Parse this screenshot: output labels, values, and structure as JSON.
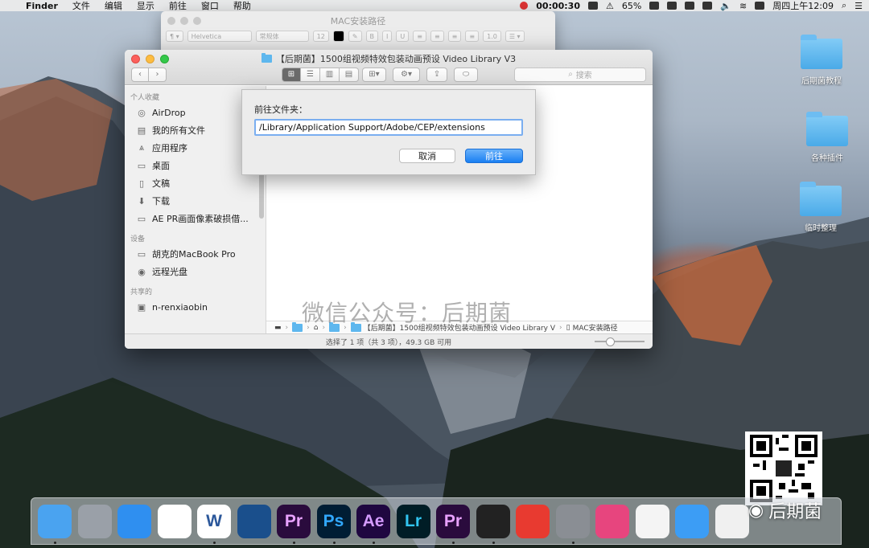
{
  "menubar": {
    "app": "Finder",
    "items": [
      "文件",
      "编辑",
      "显示",
      "前往",
      "窗口",
      "帮助"
    ],
    "timer": "00:00:30",
    "battery": "65%",
    "clock": "周四上午12:09"
  },
  "textedit": {
    "title": "MAC安装路径",
    "font": "Helvetica",
    "style": "常规体",
    "size": "12",
    "spacing": "1.0"
  },
  "finder": {
    "title": "【后期菌】1500组视频特效包装动画预设 Video Library V3",
    "search_placeholder": "搜索",
    "sidebar": {
      "favorites_header": "个人收藏",
      "favorites": [
        {
          "label": "AirDrop",
          "icon": "airdrop-icon"
        },
        {
          "label": "我的所有文件",
          "icon": "all-files-icon"
        },
        {
          "label": "应用程序",
          "icon": "applications-icon"
        },
        {
          "label": "桌面",
          "icon": "desktop-icon"
        },
        {
          "label": "文稿",
          "icon": "documents-icon"
        },
        {
          "label": "下载",
          "icon": "downloads-icon"
        },
        {
          "label": "AE PR画面像素破损借...",
          "icon": "folder-icon"
        }
      ],
      "devices_header": "设备",
      "devices": [
        {
          "label": "胡克的MacBook Pro",
          "icon": "laptop-icon"
        },
        {
          "label": "远程光盘",
          "icon": "disc-icon"
        }
      ],
      "shared_header": "共享的",
      "shared": [
        {
          "label": "n-renxiaobin",
          "icon": "monitor-icon"
        }
      ]
    },
    "pathbar": [
      "【后期菌】1500组视频特效包装动画预设 Video Library V",
      "MAC安装路径"
    ],
    "status": "选择了 1 项（共 3 项），49.3 GB 可用"
  },
  "goto_sheet": {
    "label": "前往文件夹：",
    "path_value": "/Library/Application Support/Adobe/CEP/extensions",
    "cancel": "取消",
    "go": "前往"
  },
  "desktop_folders": [
    "后期菌教程",
    "各种插件",
    "临时整理"
  ],
  "watermark": "微信公众号：后期菌",
  "wechat_brand": "后期菌",
  "dock": [
    {
      "name": "finder-dock-icon",
      "text": "",
      "bg": "#4aa3f0",
      "fg": "#fff"
    },
    {
      "name": "launchpad-dock-icon",
      "text": "",
      "bg": "#9aa0a8",
      "fg": "#fff"
    },
    {
      "name": "safari-dock-icon",
      "text": "",
      "bg": "#2f8ff0",
      "fg": "#fff"
    },
    {
      "name": "photos-dock-icon",
      "text": "",
      "bg": "#ffffff",
      "fg": "#e0474c"
    },
    {
      "name": "word-dock-icon",
      "text": "W",
      "bg": "#ffffff",
      "fg": "#2b579a"
    },
    {
      "name": "quicktime-dock-icon",
      "text": "",
      "bg": "#1a4f8c",
      "fg": "#e33"
    },
    {
      "name": "premiere-dock-icon",
      "text": "Pr",
      "bg": "#2a0b3d",
      "fg": "#e9a2ff"
    },
    {
      "name": "photoshop-dock-icon",
      "text": "Ps",
      "bg": "#001d34",
      "fg": "#31a8ff"
    },
    {
      "name": "after-effects-dock-icon",
      "text": "Ae",
      "bg": "#1f0740",
      "fg": "#d49bff"
    },
    {
      "name": "lightroom-dock-icon",
      "text": "Lr",
      "bg": "#001d26",
      "fg": "#31c5f0"
    },
    {
      "name": "premiere-2-dock-icon",
      "text": "Pr",
      "bg": "#2a0b3d",
      "fg": "#e9a2ff"
    },
    {
      "name": "final-cut-dock-icon",
      "text": "",
      "bg": "#222",
      "fg": "#fff"
    },
    {
      "name": "netease-music-dock-icon",
      "text": "",
      "bg": "#e83a30",
      "fg": "#fff"
    },
    {
      "name": "system-preferences-dock-icon",
      "text": "",
      "bg": "#8a8e94",
      "fg": "#fff"
    },
    {
      "name": "cleanmymac-dock-icon",
      "text": "",
      "bg": "#e7457e",
      "fg": "#fff"
    },
    {
      "name": "facetime-dock-icon",
      "text": "",
      "bg": "#f4f4f4",
      "fg": "#1bb24a"
    },
    {
      "name": "video-dock-icon",
      "text": "",
      "bg": "#3c9df5",
      "fg": "#fff"
    },
    {
      "name": "notes-dock-icon",
      "text": "",
      "bg": "#f0f0f0",
      "fg": "#888"
    }
  ]
}
